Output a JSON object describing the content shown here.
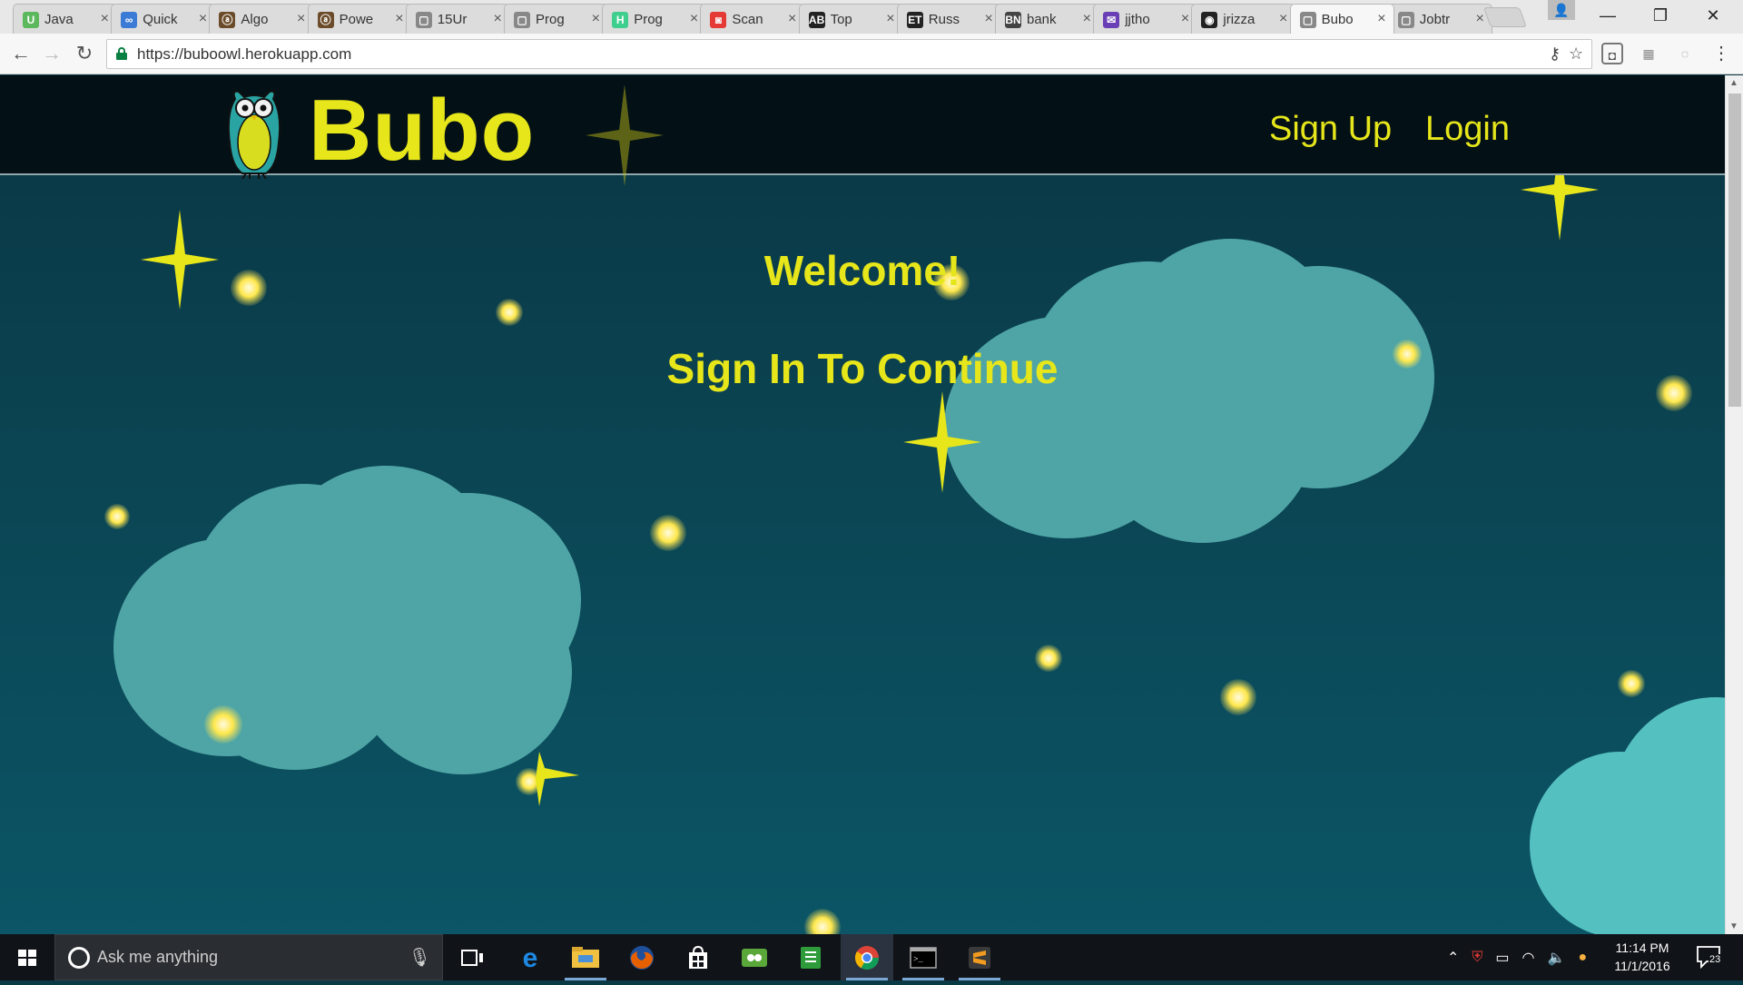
{
  "browser": {
    "tabs": [
      {
        "label": "Java",
        "favicon": "U",
        "favicon_color": "#5cb85c"
      },
      {
        "label": "Quick",
        "favicon": "∞",
        "favicon_color": "#3b7bd6"
      },
      {
        "label": "Algo",
        "favicon": "ⓐ",
        "favicon_color": "#6b4b2a"
      },
      {
        "label": "Powe",
        "favicon": "ⓐ",
        "favicon_color": "#6b4b2a"
      },
      {
        "label": "15Ur",
        "favicon": "▢",
        "favicon_color": "#888888"
      },
      {
        "label": "Prog",
        "favicon": "▢",
        "favicon_color": "#888888"
      },
      {
        "label": "Prog",
        "favicon": "H",
        "favicon_color": "#3ecf8e"
      },
      {
        "label": "Scan",
        "favicon": "◙",
        "favicon_color": "#e53935"
      },
      {
        "label": "Top",
        "favicon": "AB",
        "favicon_color": "#222222"
      },
      {
        "label": "Russ",
        "favicon": "ET",
        "favicon_color": "#222222"
      },
      {
        "label": "bank",
        "favicon": "BN",
        "favicon_color": "#444444"
      },
      {
        "label": "jjtho",
        "favicon": "✉",
        "favicon_color": "#6a3fb5"
      },
      {
        "label": "jrizza",
        "favicon": "◉",
        "favicon_color": "#222222"
      },
      {
        "label": "Bubo",
        "favicon": "▢",
        "favicon_color": "#888888",
        "active": true
      },
      {
        "label": "Jobtr",
        "favicon": "▢",
        "favicon_color": "#888888"
      }
    ],
    "url": "https://buboowl.herokuapp.com",
    "window_controls": {
      "minimize": "—",
      "maximize": "❐",
      "close": "✕"
    }
  },
  "site": {
    "brand": "Bubo",
    "nav": {
      "signup": "Sign Up",
      "login": "Login"
    },
    "hero": {
      "welcome": "Welcome!",
      "signin": "Sign In To Continue"
    },
    "colors": {
      "accent": "#e6e61a",
      "header_bg": "#031016",
      "sky": "#0b4351",
      "cloud": "#4fa5a6"
    }
  },
  "taskbar": {
    "search_placeholder": "Ask me anything",
    "apps": [
      "task-view-icon",
      "edge-icon",
      "file-explorer-icon",
      "firefox-icon",
      "store-icon",
      "evernote-icon",
      "notes-icon",
      "chrome-icon",
      "terminal-icon",
      "sublime-icon"
    ],
    "time": "11:14 PM",
    "date": "11/1/2016",
    "notifications": "23"
  }
}
